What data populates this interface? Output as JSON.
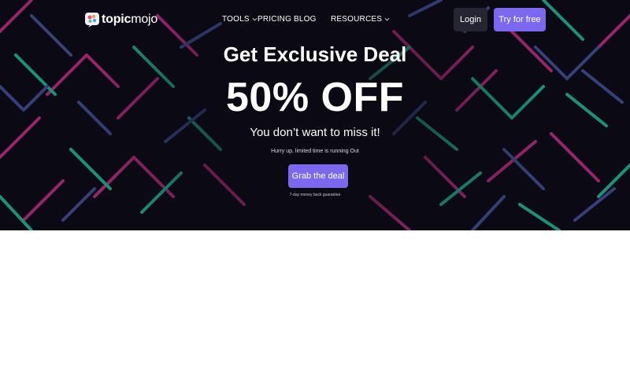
{
  "brand": {
    "name_bold": "topic",
    "name_thin": "mojo"
  },
  "nav": {
    "tools": "TOOLS",
    "pricing": "PRICING",
    "blog": "BLOG",
    "resources": "RESOURCES",
    "login": "Login",
    "try": "Try for free"
  },
  "hero": {
    "title": "Get Exclusive Deal",
    "discount": "50% OFF",
    "subtitle": "You don’t want to miss it!",
    "urgency": "Hurry up, limited time is running Out",
    "cta": "Grab the deal",
    "guarantee": "7-day money back guarantee"
  },
  "colors": {
    "hero_bg": "#0b0a14",
    "accent": "#7b68ee",
    "login_bg": "#262533",
    "pattern_pink": "#b02a7a",
    "pattern_teal": "#1fa98a",
    "pattern_blue": "#3c4a8a"
  }
}
